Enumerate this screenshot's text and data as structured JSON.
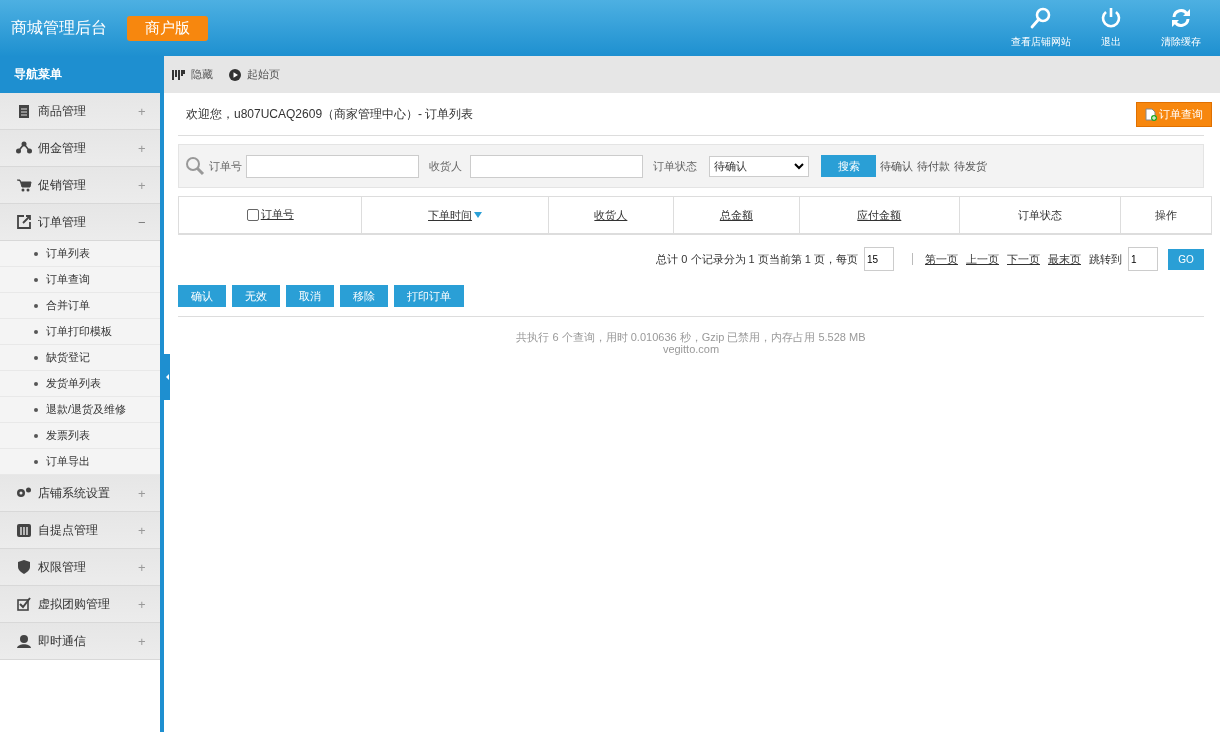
{
  "header": {
    "title": "商城管理后台",
    "badge": "商户版",
    "actions": [
      {
        "label": "查看店铺网站"
      },
      {
        "label": "退出"
      },
      {
        "label": "清除缓存"
      }
    ]
  },
  "sidebar": {
    "title": "导航菜单",
    "items": [
      {
        "label": "商品管理",
        "expanded": false,
        "toggle": "+"
      },
      {
        "label": "佣金管理",
        "expanded": false,
        "toggle": "+"
      },
      {
        "label": "促销管理",
        "expanded": false,
        "toggle": "+"
      },
      {
        "label": "订单管理",
        "expanded": true,
        "toggle": "−",
        "children": [
          {
            "label": "订单列表"
          },
          {
            "label": "订单查询"
          },
          {
            "label": "合并订单"
          },
          {
            "label": "订单打印模板"
          },
          {
            "label": "缺货登记"
          },
          {
            "label": "发货单列表"
          },
          {
            "label": "退款/退货及维修"
          },
          {
            "label": "发票列表"
          },
          {
            "label": "订单导出"
          }
        ]
      },
      {
        "label": "店铺系统设置",
        "expanded": false,
        "toggle": "+"
      },
      {
        "label": "自提点管理",
        "expanded": false,
        "toggle": "+"
      },
      {
        "label": "权限管理",
        "expanded": false,
        "toggle": "+"
      },
      {
        "label": "虚拟团购管理",
        "expanded": false,
        "toggle": "+"
      },
      {
        "label": "即时通信",
        "expanded": false,
        "toggle": "+"
      }
    ]
  },
  "toolbar": {
    "items": [
      {
        "label": "隐藏"
      },
      {
        "label": "起始页"
      }
    ]
  },
  "page": {
    "welcome": "欢迎您，u807UCAQ2609（商家管理中心）- 订单列表",
    "action_button": "订单查询"
  },
  "search": {
    "order_no_label": "订单号",
    "consignee_label": "收货人",
    "status_label": "订单状态",
    "status_value": "待确认",
    "button": "搜索",
    "quick_links": [
      {
        "label": "待确认"
      },
      {
        "label": "待付款"
      },
      {
        "label": "待发货"
      }
    ]
  },
  "table": {
    "columns": [
      {
        "label": "订单号",
        "kind": "checkbox",
        "checked": false
      },
      {
        "label": "下单时间",
        "kind": "sorted"
      },
      {
        "label": "收货人",
        "kind": "sortable"
      },
      {
        "label": "总金额",
        "kind": "sortable"
      },
      {
        "label": "应付金额",
        "kind": "sortable"
      },
      {
        "label": "订单状态",
        "kind": "plain"
      },
      {
        "label": "操作",
        "kind": "plain"
      }
    ]
  },
  "pagination": {
    "summary": "总计 0 个记录分为 1 页当前第 1 页，每页",
    "per_page": "15",
    "links": [
      {
        "label": "第一页"
      },
      {
        "label": "上一页"
      },
      {
        "label": "下一页"
      },
      {
        "label": "最末页"
      }
    ],
    "jump_label": "跳转到",
    "jump_value": "1",
    "go": "GO"
  },
  "batch_buttons": [
    {
      "label": "确认"
    },
    {
      "label": "无效"
    },
    {
      "label": "取消"
    },
    {
      "label": "移除"
    },
    {
      "label": "打印订单"
    }
  ],
  "footer": {
    "stats": "共执行 6 个查询，用时 0.010636 秒，Gzip 已禁用，内存占用 5.528 MB",
    "site": "vegitto.com"
  }
}
